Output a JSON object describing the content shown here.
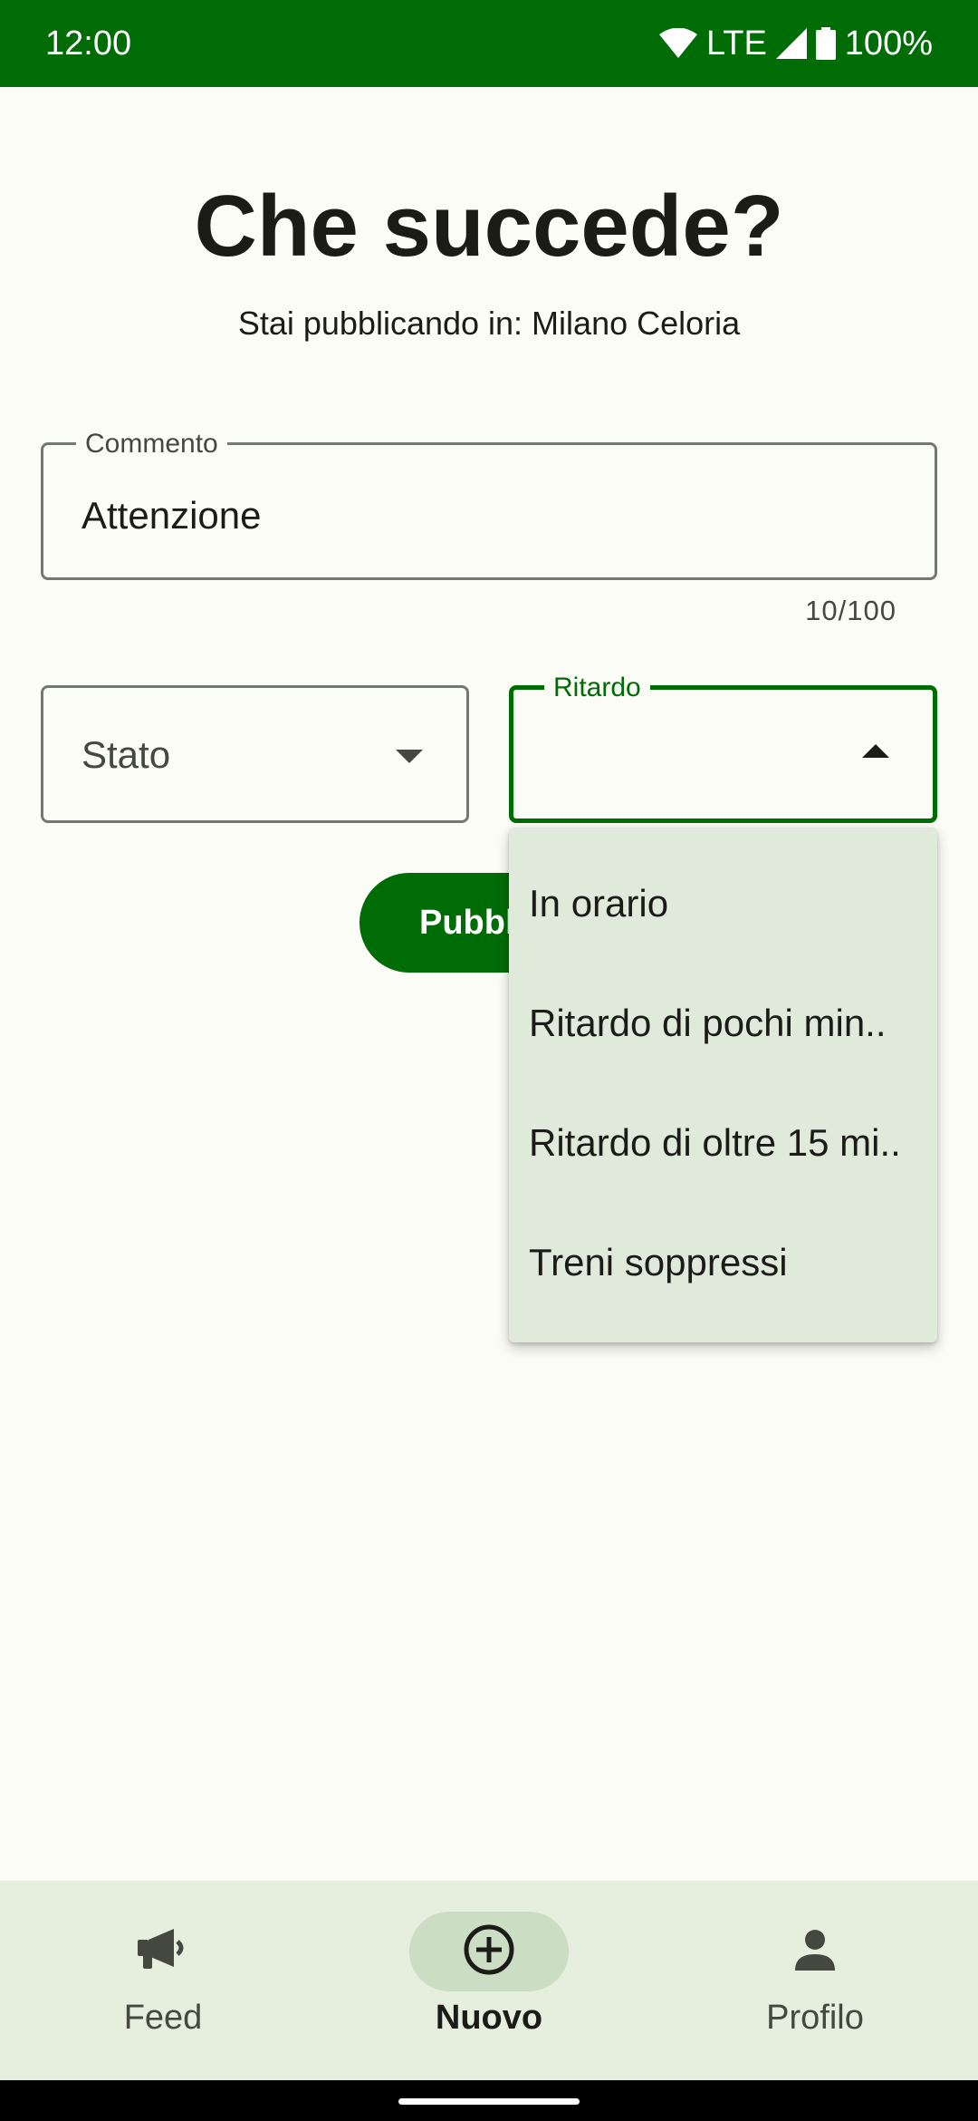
{
  "status_bar": {
    "time": "12:00",
    "network": "LTE",
    "battery": "100%",
    "icons": [
      "wifi-icon",
      "signal-icon",
      "battery-icon"
    ]
  },
  "header": {
    "title": "Che succede?",
    "subtitle": "Stai pubblicando in: Milano Celoria"
  },
  "form": {
    "comment": {
      "label": "Commento",
      "value": "Attenzione",
      "counter": "10/100"
    },
    "stato": {
      "placeholder": "Stato"
    },
    "ritardo": {
      "label": "Ritardo",
      "value": ""
    },
    "publish_label": "Pubbl"
  },
  "dropdown": {
    "items": [
      "In orario",
      "Ritardo di pochi min..",
      "Ritardo di oltre 15 mi..",
      "Treni soppressi"
    ]
  },
  "bottom_nav": {
    "items": [
      {
        "label": "Feed",
        "icon": "megaphone-icon",
        "active": false
      },
      {
        "label": "Nuovo",
        "icon": "add-circle-icon",
        "active": true
      },
      {
        "label": "Profilo",
        "icon": "person-icon",
        "active": false
      }
    ]
  },
  "colors": {
    "primary": "#006C05",
    "background": "#FBFCF6",
    "menu_background": "#E0EADB",
    "nav_background": "#E6EEDE",
    "nav_active_pill": "#CBDDC2"
  }
}
